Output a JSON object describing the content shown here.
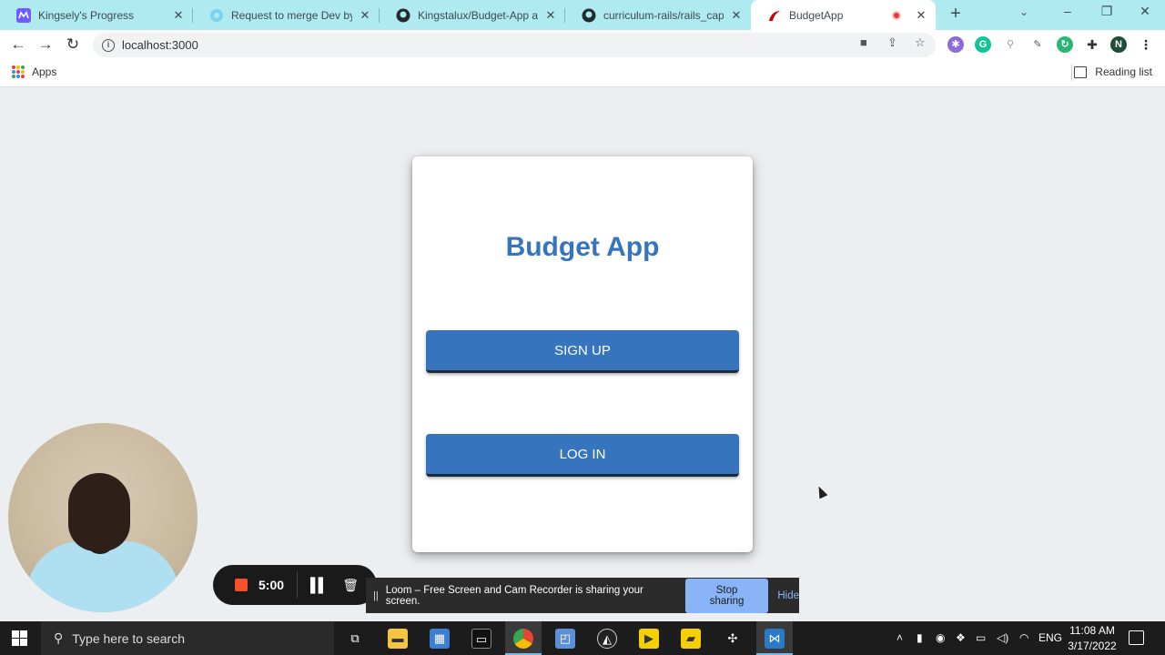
{
  "browser": {
    "tabs": [
      {
        "title": "Kingsely's Progress",
        "icon": "microverse-icon",
        "color": "#6d5cff"
      },
      {
        "title": "Request to merge Dev by Kin",
        "icon": "github-pr-icon",
        "color": "#7ad2f0"
      },
      {
        "title": "Kingstalux/Budget-App at de",
        "icon": "github-icon",
        "color": "#24292f"
      },
      {
        "title": "curriculum-rails/rails_capstone",
        "icon": "github-icon",
        "color": "#24292f"
      },
      {
        "title": "BudgetApp",
        "icon": "rails-icon",
        "color": "#cc0000",
        "active": true
      }
    ],
    "url": "localhost:3000",
    "bookmarks": {
      "apps_label": "Apps",
      "reading_list_label": "Reading list"
    },
    "profile_initial": "N"
  },
  "page": {
    "title": "Budget App",
    "signup_label": "SIGN UP",
    "login_label": "LOG IN",
    "accent_color": "#3674bd"
  },
  "loom": {
    "timer": "5:00",
    "share_message": "Loom – Free Screen and Cam Recorder is sharing your screen.",
    "stop_sharing_label": "Stop sharing",
    "hide_label": "Hide"
  },
  "taskbar": {
    "search_placeholder": "Type here to search",
    "language": "ENG",
    "time": "11:08 AM",
    "date": "3/17/2022"
  }
}
